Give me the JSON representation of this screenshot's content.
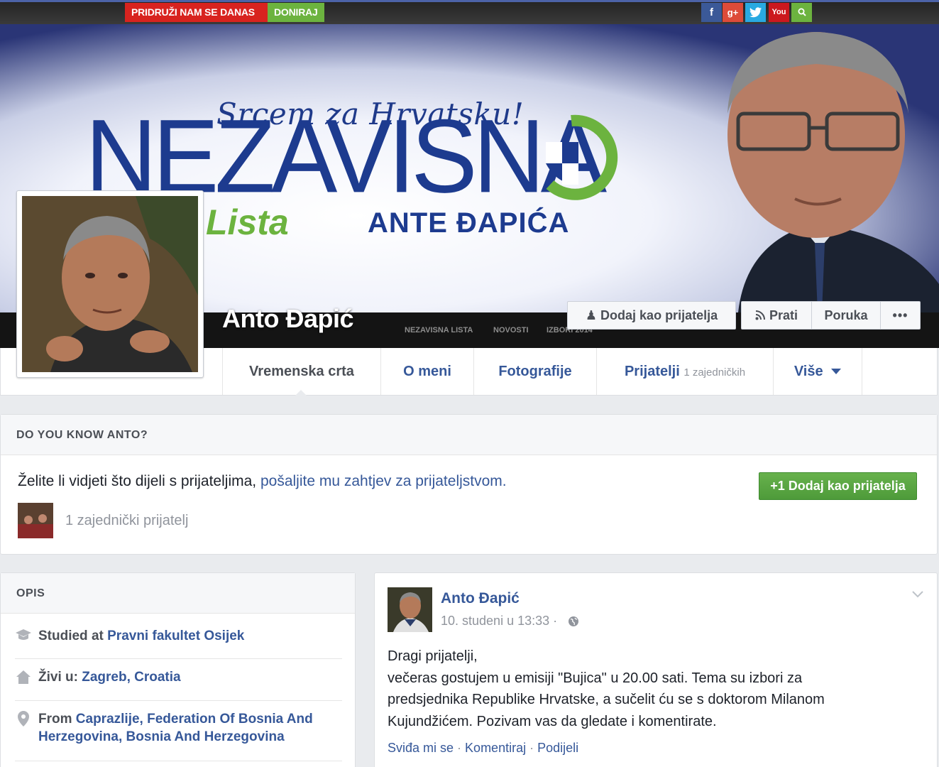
{
  "cover": {
    "join_label": "PRIDRUŽI NAM SE DANAS",
    "donate_label": "DONIRAJ",
    "social": {
      "facebook": "f",
      "googleplus": "g+",
      "twitter": "t",
      "youtube": "You",
      "search": "search-icon"
    },
    "slogan": "Srcem za Hrvatsku!",
    "party_name": "NEZAVISNA",
    "party_lista": "Lista",
    "leader": "ANTE ĐAPIĆA",
    "nav_items": [
      "NEZAVISNA LISTA",
      "NOVOSTI",
      "IZBORI 2014"
    ],
    "colors": {
      "red": "#d8231f",
      "green": "#6cb33f",
      "blue": "#1d3b8f"
    }
  },
  "profile": {
    "name": "Anto Đapić",
    "add_friend": "Dodaj kao prijatelja",
    "follow": "Prati",
    "message": "Poruka",
    "more": "•••"
  },
  "tabs": {
    "timeline": "Vremenska crta",
    "about": "O meni",
    "photos": "Fotografije",
    "friends": "Prijatelji",
    "friends_count": "1 zajedničkih",
    "more": "Više"
  },
  "know": {
    "header": "DO YOU KNOW ANTO?",
    "text": "Želite li vidjeti što dijeli s prijateljima,",
    "link": "pošaljite mu zahtjev za prijateljstvom.",
    "button": "Dodaj kao prijatelja",
    "mutual": "1 zajednički prijatelj"
  },
  "opis": {
    "header": "OPIS",
    "edu_prefix": "Studied at",
    "edu_link": "Pravni fakultet Osijek",
    "live_prefix": "Živi u:",
    "live_link": "Zagreb, Croatia",
    "from_prefix": "From",
    "from_link_1": "Caprazlije, Federation Of Bosnia And",
    "from_link_2": "Herzegovina, Bosnia And Herzegovina"
  },
  "post": {
    "author": "Anto Đapić",
    "time": "10. studeni u 13:33 ·",
    "lines": [
      "Dragi prijatelji,",
      "večeras gostujem u emisiji \"Bujica\" u 20.00 sati. Tema su izbori za",
      "predsjednika Republike Hrvatske, a sučelit ću se s doktorom Milanom",
      "Kujundžićem. Pozivam vas da gledate i komentirate."
    ],
    "like": "Sviđa mi se",
    "comment": "Komentiraj",
    "share": "Podijeli",
    "sep": " · "
  }
}
